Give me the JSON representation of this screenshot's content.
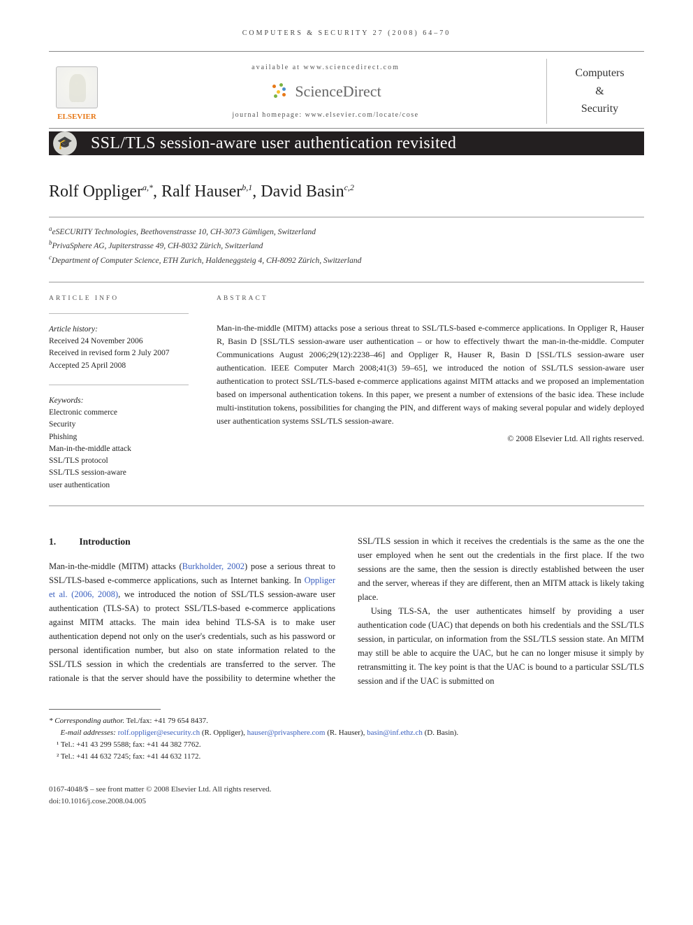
{
  "journal_header": {
    "running_head": "COMPUTERS & SECURITY 27 (2008) 64–70",
    "available_at": "available at www.sciencedirect.com",
    "science_direct": "ScienceDirect",
    "journal_homepage": "journal homepage: www.elsevier.com/locate/cose",
    "publisher_logo_label": "ELSEVIER",
    "journal_name_line1": "Computers",
    "journal_name_line2": "&",
    "journal_name_line3": "Security"
  },
  "title": "SSL/TLS session-aware user authentication revisited",
  "badge_glyph": "🎓",
  "authors": [
    {
      "name": "Rolf Oppliger",
      "marks": "a,*"
    },
    {
      "name": "Ralf Hauser",
      "marks": "b,1"
    },
    {
      "name": "David Basin",
      "marks": "c,2"
    }
  ],
  "affiliations": [
    {
      "mark": "a",
      "text": "eSECURITY Technologies, Beethovenstrasse 10, CH-3073 Gümligen, Switzerland"
    },
    {
      "mark": "b",
      "text": "PrivaSphere AG, Jupiterstrasse 49, CH-8032 Zürich, Switzerland"
    },
    {
      "mark": "c",
      "text": "Department of Computer Science, ETH Zurich, Haldeneggsteig 4, CH-8092 Zürich, Switzerland"
    }
  ],
  "article_info": {
    "heading": "ARTICLE INFO",
    "history_label": "Article history:",
    "received": "Received 24 November 2006",
    "revised": "Received in revised form 2 July 2007",
    "accepted": "Accepted 25 April 2008",
    "keywords_label": "Keywords:",
    "keywords": [
      "Electronic commerce",
      "Security",
      "Phishing",
      "Man-in-the-middle attack",
      "SSL/TLS protocol",
      "SSL/TLS session-aware",
      "user authentication"
    ]
  },
  "abstract": {
    "heading": "ABSTRACT",
    "text": "Man-in-the-middle (MITM) attacks pose a serious threat to SSL/TLS-based e-commerce applications. In Oppliger R, Hauser R, Basin D [SSL/TLS session-aware user authentication – or how to effectively thwart the man-in-the-middle. Computer Communications August 2006;29(12):2238–46] and Oppliger R, Hauser R, Basin D [SSL/TLS session-aware user authentication. IEEE Computer March 2008;41(3) 59–65], we introduced the notion of SSL/TLS session-aware user authentication to protect SSL/TLS-based e-commerce applications against MITM attacks and we proposed an implementation based on impersonal authentication tokens. In this paper, we present a number of extensions of the basic idea. These include multi-institution tokens, possibilities for changing the PIN, and different ways of making several popular and widely deployed user authentication systems SSL/TLS session-aware.",
    "copyright": "© 2008 Elsevier Ltd. All rights reserved."
  },
  "section1": {
    "number": "1.",
    "title": "Introduction",
    "p1_a": "Man-in-the-middle (MITM) attacks (",
    "p1_link1": "Burkholder, 2002",
    "p1_b": ") pose a serious threat to SSL/TLS-based e-commerce applications, such as Internet banking. In ",
    "p1_link2": "Oppliger et al. (2006, 2008)",
    "p1_c": ", we introduced the notion of SSL/TLS session-aware user authentication (TLS-SA) to protect SSL/TLS-based e-commerce applications against MITM attacks. The main idea behind TLS-SA is to make user authentication depend not only on the user's credentials, such as his password or personal identification number, but also on state information related to the SSL/TLS session in which the credentials are transferred to the server. The rationale is that the server should have the possibility to",
    "p2": "determine whether the SSL/TLS session in which it receives the credentials is the same as the one the user employed when he sent out the credentials in the first place. If the two sessions are the same, then the session is directly established between the user and the server, whereas if they are different, then an MITM attack is likely taking place.",
    "p3": "Using TLS-SA, the user authenticates himself by providing a user authentication code (UAC) that depends on both his credentials and the SSL/TLS session, in particular, on information from the SSL/TLS session state. An MITM may still be able to acquire the UAC, but he can no longer misuse it simply by retransmitting it. The key point is that the UAC is bound to a particular SSL/TLS session and if the UAC is submitted on"
  },
  "footnotes": {
    "corr_label": "* Corresponding author.",
    "corr_telfax": " Tel./fax: +41 79 654 8437.",
    "emails_label": "E-mail addresses: ",
    "emails": [
      {
        "addr": "rolf.oppliger@esecurity.ch",
        "who": " (R. Oppliger), "
      },
      {
        "addr": "hauser@privasphere.com",
        "who": " (R. Hauser), "
      },
      {
        "addr": "basin@inf.ethz.ch",
        "who": " (D. Basin)."
      }
    ],
    "fn1": "¹ Tel.: +41 43 299 5588; fax: +41 44 382 7762.",
    "fn2": "² Tel.: +41 44 632 7245; fax: +41 44 632 1172."
  },
  "footer": {
    "line1": "0167-4048/$ – see front matter © 2008 Elsevier Ltd. All rights reserved.",
    "line2": "doi:10.1016/j.cose.2008.04.005"
  }
}
